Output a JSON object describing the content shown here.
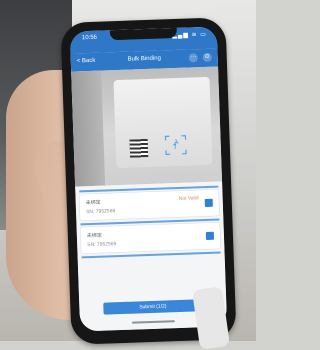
{
  "statusbar": {
    "time": "10:56",
    "indicators": "▂▄▆ ≋ ▭"
  },
  "navbar": {
    "back_label": "< Back",
    "title": "Bulk Binding",
    "btn1": "···",
    "btn2": "⊙"
  },
  "list": {
    "items": [
      {
        "name": "未绑定",
        "sn": "SN: 7952568",
        "status": "Not Valid"
      },
      {
        "name": "未绑定",
        "sn": "SN: 7952569",
        "status": ""
      }
    ]
  },
  "bottom": {
    "submit_label": "Submit (1/2)"
  },
  "colors": {
    "accent": "#2f78c8",
    "button": "#3a86d8"
  }
}
